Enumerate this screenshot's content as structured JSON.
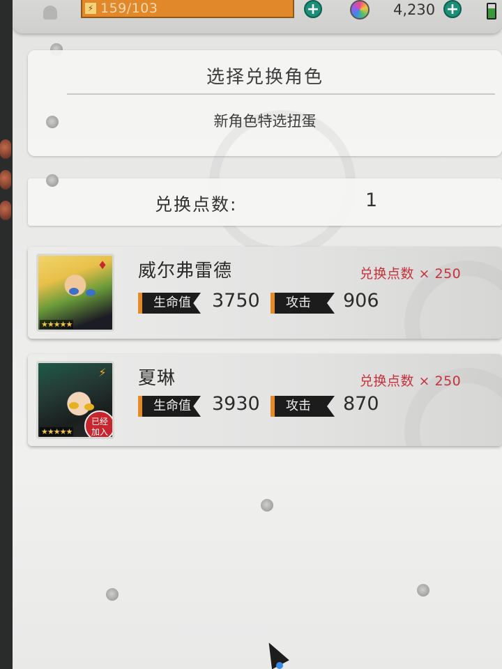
{
  "topbar": {
    "stamina_text": "159/103",
    "gem_count": "4,230",
    "icons": [
      "bell-icon",
      "lightning-icon",
      "plus-icon",
      "gem-icon",
      "plus-icon",
      "battery-icon"
    ]
  },
  "select_panel": {
    "title": "选择兑换角色",
    "subtitle": "新角色特选扭蛋"
  },
  "points_panel": {
    "label": "兑换点数:",
    "value": "1"
  },
  "characters": [
    {
      "name": "威尔弗雷德",
      "cost": "兑换点数 × 250",
      "hp_label": "生命值",
      "hp": "3750",
      "atk_label": "攻击",
      "atk": "906",
      "stars": "★★★★★",
      "class_icon": "card-suit-icon"
    },
    {
      "name": "夏琳",
      "cost": "兑换点数 × 250",
      "hp_label": "生命值",
      "hp": "3930",
      "atk_label": "攻击",
      "atk": "870",
      "stars": "★★★★★",
      "class_icon": "lightning-icon",
      "badge": "已经加入"
    }
  ],
  "colors": {
    "accent_orange": "#e48a2a",
    "cost_red": "#c8303a",
    "plus_green": "#1c8d76",
    "badge_red": "#c8262e"
  }
}
